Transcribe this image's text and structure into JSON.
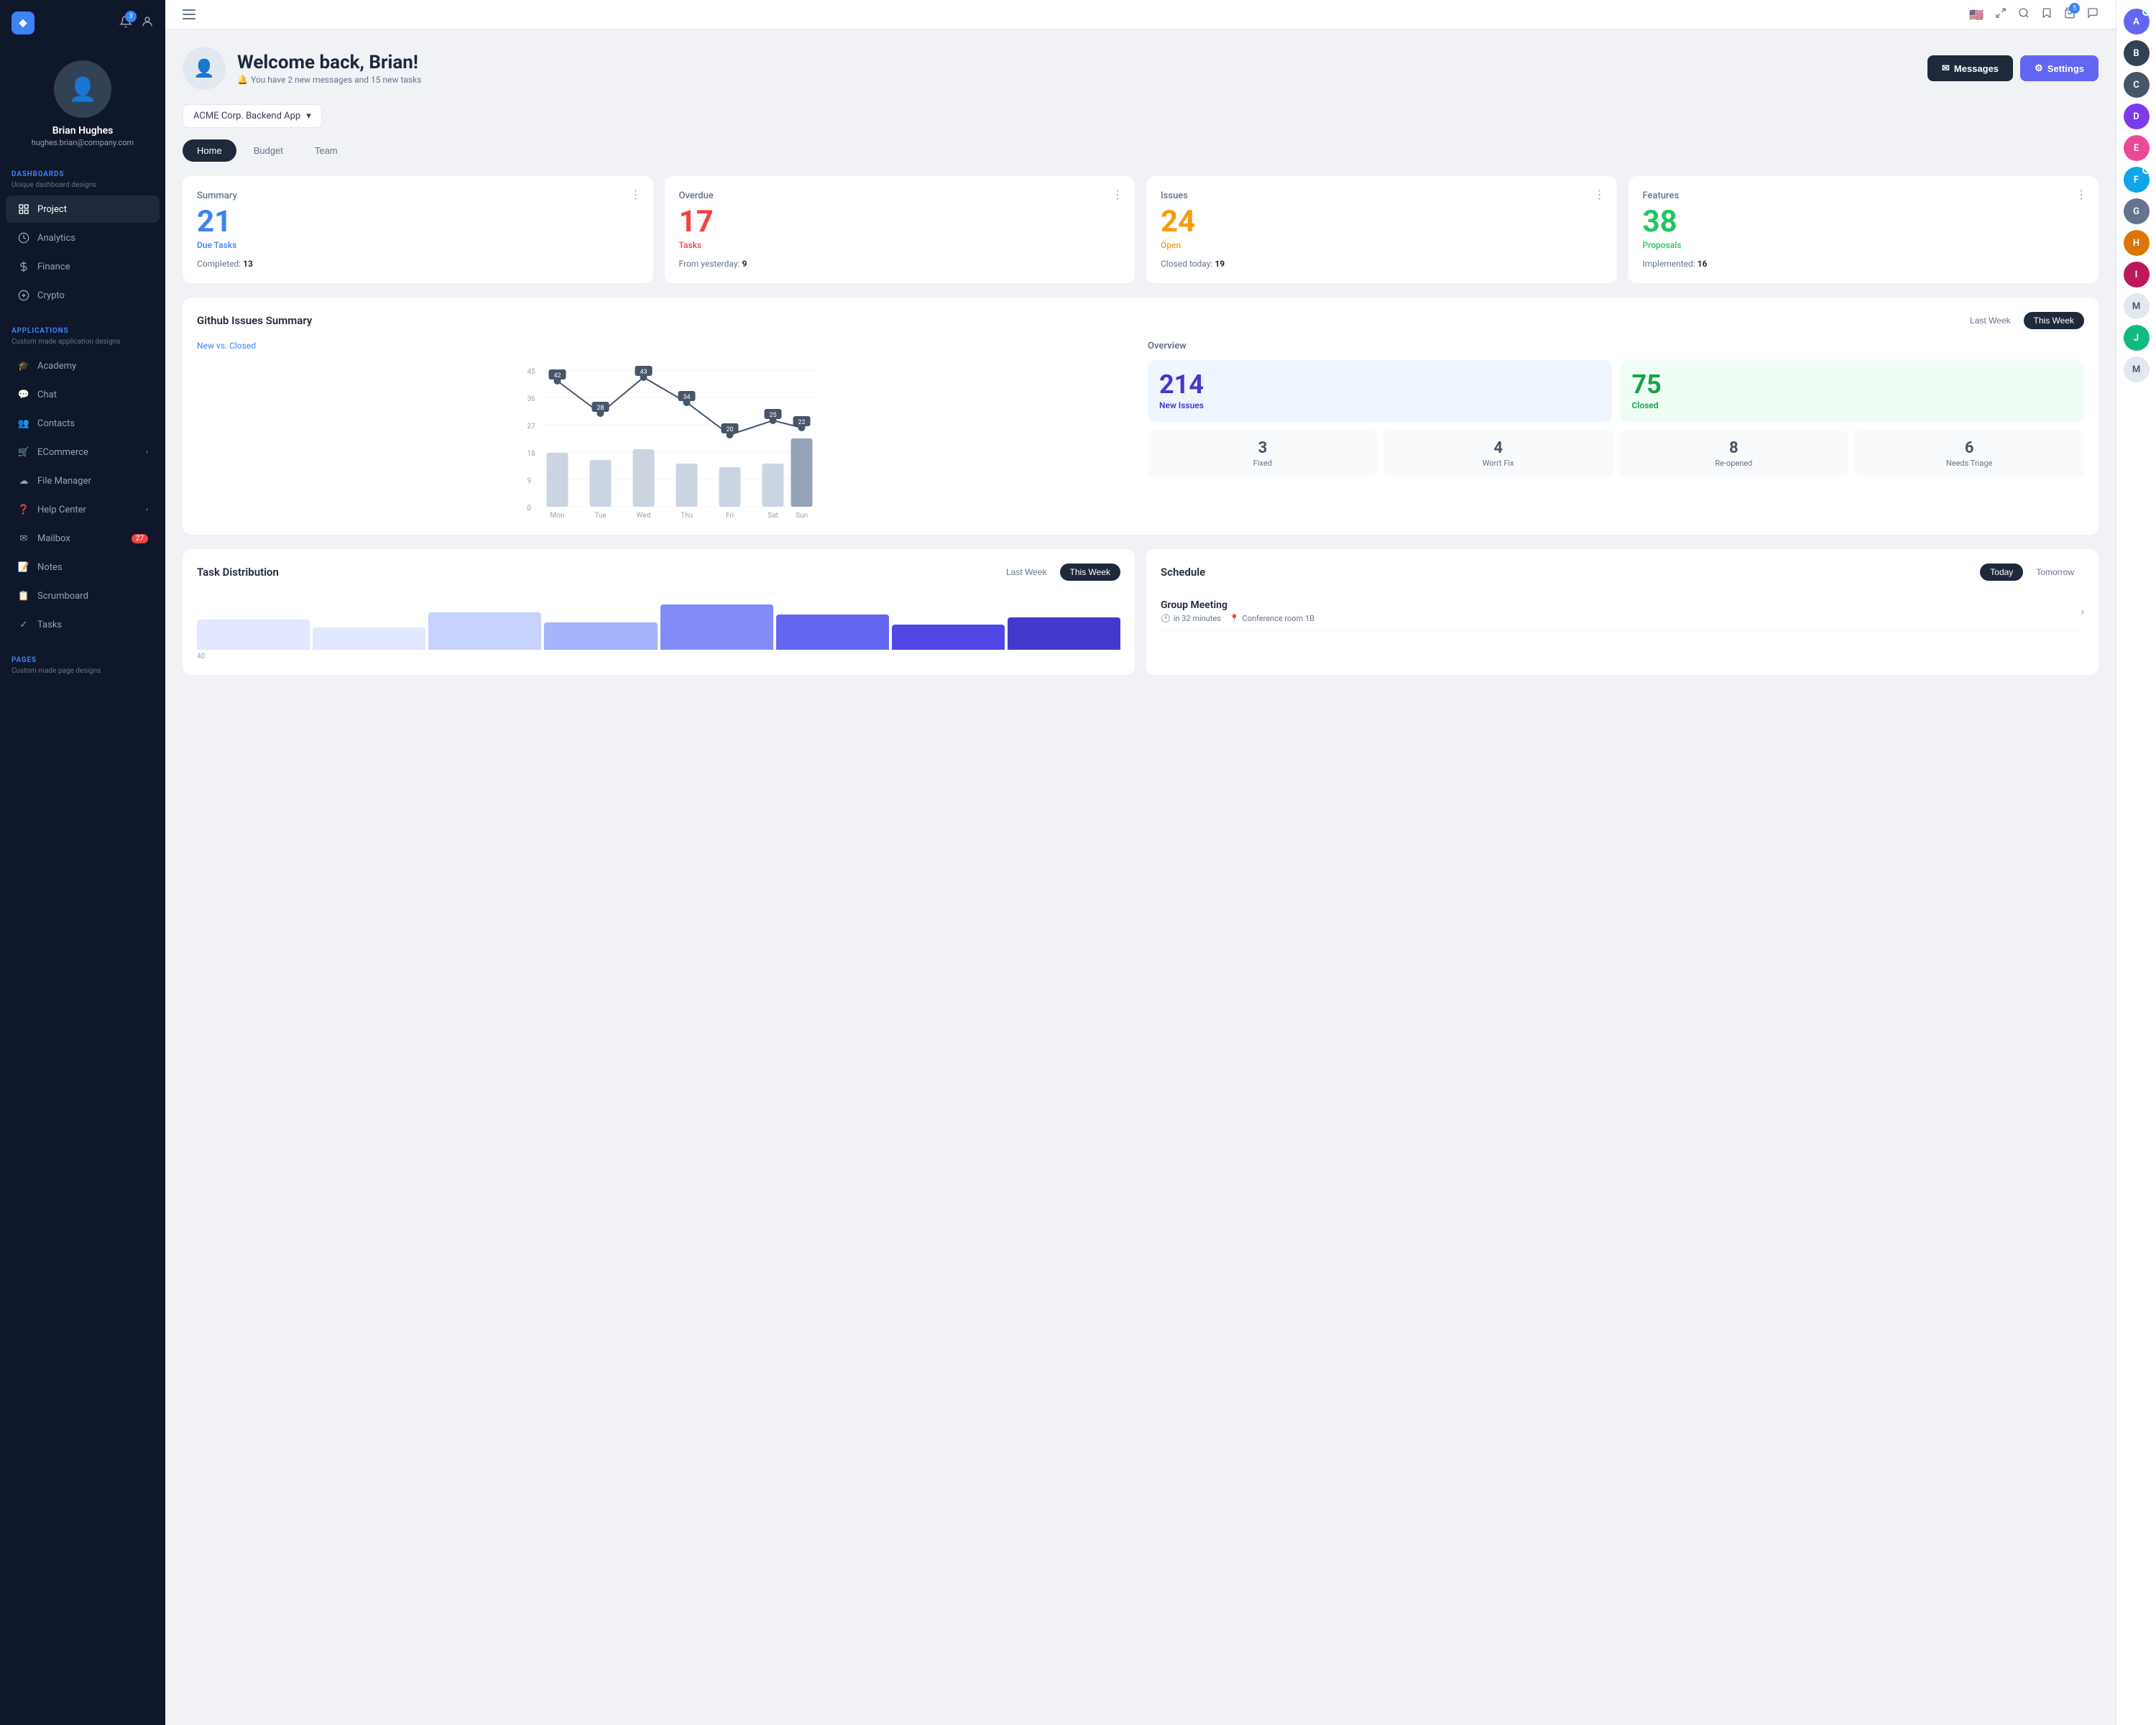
{
  "sidebar": {
    "logo": "◆",
    "notification_count": "3",
    "user": {
      "name": "Brian Hughes",
      "email": "hughes.brian@company.com"
    },
    "dashboards_label": "DASHBOARDS",
    "dashboards_sub": "Unique dashboard designs",
    "nav_items": [
      {
        "id": "project",
        "label": "Project",
        "icon": "☰",
        "active": true
      },
      {
        "id": "analytics",
        "label": "Analytics",
        "icon": "◎"
      },
      {
        "id": "finance",
        "label": "Finance",
        "icon": "💰"
      },
      {
        "id": "crypto",
        "label": "Crypto",
        "icon": "$"
      }
    ],
    "applications_label": "APPLICATIONS",
    "applications_sub": "Custom made application designs",
    "app_items": [
      {
        "id": "academy",
        "label": "Academy",
        "icon": "🎓"
      },
      {
        "id": "chat",
        "label": "Chat",
        "icon": "💬"
      },
      {
        "id": "contacts",
        "label": "Contacts",
        "icon": "👥"
      },
      {
        "id": "ecommerce",
        "label": "ECommerce",
        "icon": "🛒",
        "arrow": "›"
      },
      {
        "id": "filemanager",
        "label": "File Manager",
        "icon": "☁"
      },
      {
        "id": "helpcenter",
        "label": "Help Center",
        "icon": "❓",
        "arrow": "›"
      },
      {
        "id": "mailbox",
        "label": "Mailbox",
        "icon": "✉",
        "badge": "27"
      },
      {
        "id": "notes",
        "label": "Notes",
        "icon": "📝"
      },
      {
        "id": "scrumboard",
        "label": "Scrumboard",
        "icon": "📋"
      },
      {
        "id": "tasks",
        "label": "Tasks",
        "icon": "✓"
      }
    ],
    "pages_label": "PAGES",
    "pages_sub": "Custom made page designs"
  },
  "topbar": {
    "flag": "🇺🇸",
    "cart_badge": "5"
  },
  "welcome": {
    "title": "Welcome back, Brian!",
    "subtitle": "You have 2 new messages and 15 new tasks",
    "messages_btn": "Messages",
    "settings_btn": "Settings"
  },
  "project_selector": {
    "label": "ACME Corp. Backend App"
  },
  "tabs": [
    {
      "id": "home",
      "label": "Home",
      "active": true
    },
    {
      "id": "budget",
      "label": "Budget"
    },
    {
      "id": "team",
      "label": "Team"
    }
  ],
  "stats": [
    {
      "id": "summary",
      "label": "Summary",
      "number": "21",
      "sublabel": "Due Tasks",
      "color": "blue",
      "footer_label": "Completed:",
      "footer_value": "13"
    },
    {
      "id": "overdue",
      "label": "Overdue",
      "number": "17",
      "sublabel": "Tasks",
      "color": "red",
      "footer_label": "From yesterday:",
      "footer_value": "9"
    },
    {
      "id": "issues",
      "label": "Issues",
      "number": "24",
      "sublabel": "Open",
      "color": "orange",
      "footer_label": "Closed today:",
      "footer_value": "19"
    },
    {
      "id": "features",
      "label": "Features",
      "number": "38",
      "sublabel": "Proposals",
      "color": "green",
      "footer_label": "Implemented:",
      "footer_value": "16"
    }
  ],
  "github": {
    "title": "Github Issues Summary",
    "toggle_last": "Last Week",
    "toggle_this": "This Week",
    "chart_subtitle": "New vs. Closed",
    "overview_label": "Overview",
    "new_issues_number": "214",
    "new_issues_label": "New Issues",
    "closed_number": "75",
    "closed_label": "Closed",
    "stats": [
      {
        "number": "3",
        "label": "Fixed"
      },
      {
        "number": "4",
        "label": "Won't Fix"
      },
      {
        "number": "8",
        "label": "Re-opened"
      },
      {
        "number": "6",
        "label": "Needs Triage"
      }
    ],
    "chart_data": {
      "days": [
        "Mon",
        "Tue",
        "Wed",
        "Thu",
        "Fri",
        "Sat",
        "Sun"
      ],
      "line_values": [
        42,
        28,
        43,
        34,
        20,
        25,
        22
      ],
      "bar_heights": [
        70,
        60,
        72,
        55,
        45,
        50,
        80
      ]
    }
  },
  "task_distribution": {
    "title": "Task Distribution",
    "toggle_last": "Last Week",
    "toggle_this": "This Week"
  },
  "schedule": {
    "title": "Schedule",
    "toggle_today": "Today",
    "toggle_tomorrow": "Tomorrow",
    "items": [
      {
        "title": "Group Meeting",
        "time": "in 32 minutes",
        "location": "Conference room 1B"
      }
    ]
  },
  "right_panel": {
    "avatars": [
      "A",
      "B",
      "C",
      "D",
      "E",
      "F",
      "G",
      "H",
      "I",
      "M",
      "J",
      "M"
    ]
  }
}
